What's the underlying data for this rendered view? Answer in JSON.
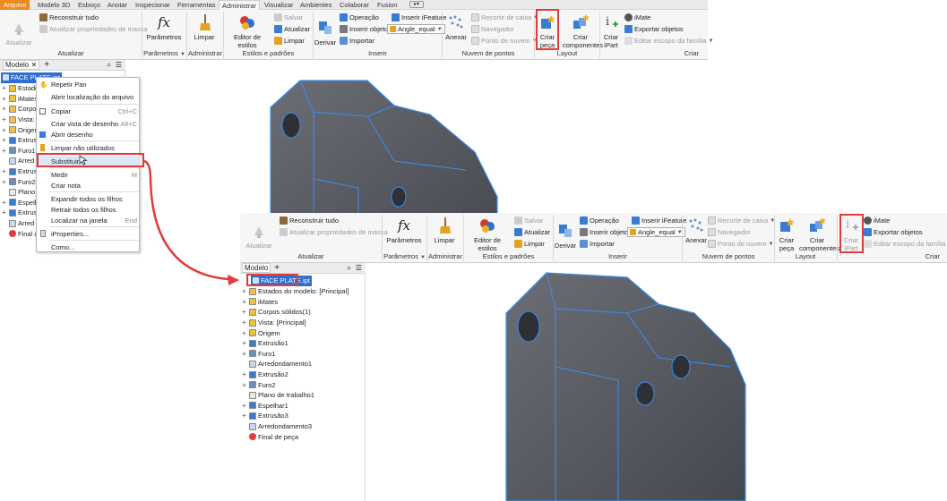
{
  "tabs": [
    "Arquivo",
    "Modelo 3D",
    "Esboço",
    "Anotar",
    "Inspecionar",
    "Ferramentas",
    "Administrar",
    "Visualizar",
    "Ambientes",
    "Colaborar",
    "Fusion"
  ],
  "ribbon": {
    "atualizar": "Atualizar",
    "reconstruir": "Reconstruir tudo",
    "atualizar_props": "Atualizar propriedades de massa",
    "parametros": "Parâmetros",
    "limpar": "Limpar",
    "editor_estilos": "Editor de estilos",
    "salvar": "Salvar",
    "atualizar_small": "Atualizar",
    "limpar_small": "Limpar",
    "derivar": "Derivar",
    "operacao": "Operação",
    "inserir_objeto": "Inserir objeto",
    "importar": "Importar",
    "inserir_ifeature": "Inserir iFeature",
    "angle_equal": "Angle_equal",
    "anexar": "Anexar",
    "recorte_caixa": "Recorte de caixa",
    "navegador": "Navegador",
    "ponto_nuvem": "Ponto de nuvem",
    "criar": "Criar",
    "peca": "peça",
    "componentes": "componentes",
    "ipart": "iPart",
    "imate": "iMate",
    "exportar_objetos": "Exportar objetos",
    "editar_escopo": "Editar escopo da família",
    "groups": {
      "atualizar": "Atualizar",
      "parametros": "Parâmetros",
      "administrar": "Administrar",
      "estilos": "Estilos e padrões",
      "inserir": "Inserir",
      "nuvem": "Nuvem de pontos",
      "layout": "Layout",
      "criar": "Criar"
    }
  },
  "browser": {
    "title": "Modelo",
    "plus": "+",
    "root": "FACE PLATE.ipt",
    "items": [
      "Estados do modelo: [Principal]",
      "iMates",
      "Corpos sólidos(1)",
      "Vista: [Principal]",
      "Origem",
      "Extrusão1",
      "Furo1",
      "Arredondamento1",
      "Extrusão2",
      "Furo2",
      "Plano de trabalho1",
      "Espelhar1",
      "Extrusão3",
      "Arredondamento3",
      "Final de peça"
    ],
    "items_trunc": [
      "Estado",
      "iMates",
      "Corpo",
      "Vista:",
      "Origem",
      "Extrus",
      "Furo1",
      "Arred",
      "Extrus",
      "Furo2",
      "Plano",
      "Espelh",
      "Extrus",
      "Arred",
      "Final d"
    ]
  },
  "context_menu": {
    "items": [
      "Repetir Pan",
      "Abrir localização do arquivo",
      "Copiar",
      "Criar vista de desenho",
      "Abrir desenho",
      "Limpar não utilizados",
      "Substituir",
      "Medir",
      "Criar nota",
      "Expandir todos os filhos",
      "Retrair todos os filhos",
      "Localizar na janela",
      "iProperties...",
      "Como..."
    ],
    "shortcuts": {
      "copiar": "Ctrl+C",
      "criar_vista": "Alt+C",
      "medir": "M",
      "localizar": "End"
    }
  },
  "colors": {
    "accent": "#e23b3b",
    "file_tab": "#ec8a1c",
    "selection": "#2f6fd1",
    "edge": "#3a8ef0",
    "body": "#55585f"
  }
}
